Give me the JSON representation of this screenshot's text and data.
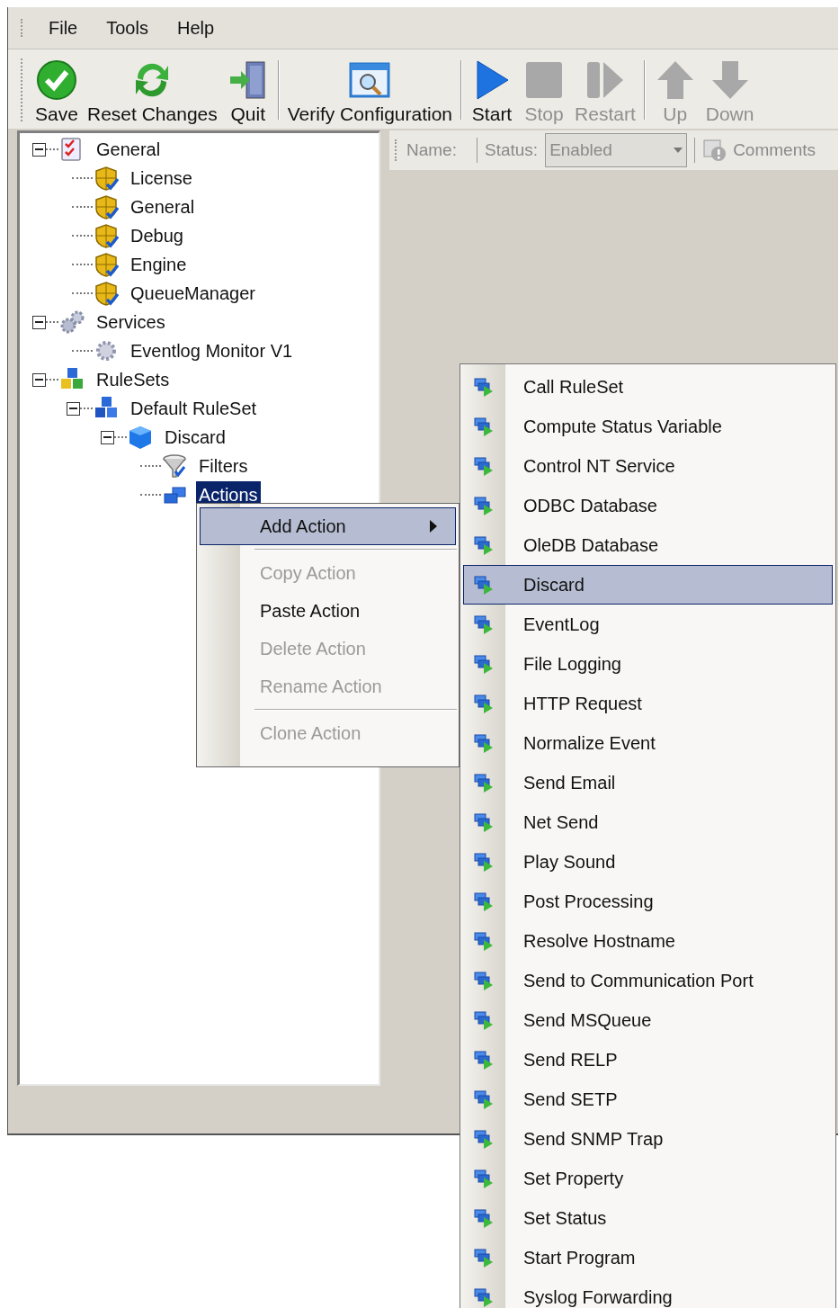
{
  "menu_bar": [
    "File",
    "Tools",
    "Help"
  ],
  "toolbar": [
    [
      {
        "label": "Save",
        "kind": "save",
        "disabled": false
      },
      {
        "label": "Reset Changes",
        "kind": "reset",
        "disabled": false
      },
      {
        "label": "Quit",
        "kind": "quit",
        "disabled": false
      }
    ],
    [
      {
        "label": "Verify Configuration",
        "kind": "verify",
        "disabled": false
      }
    ],
    [
      {
        "label": "Start",
        "kind": "start",
        "disabled": false
      },
      {
        "label": "Stop",
        "kind": "stop",
        "disabled": true
      },
      {
        "label": "Restart",
        "kind": "restart",
        "disabled": true
      }
    ],
    [
      {
        "label": "Up",
        "kind": "up",
        "disabled": true
      },
      {
        "label": "Down",
        "kind": "down",
        "disabled": true
      }
    ]
  ],
  "tree": [
    {
      "label": "General",
      "kind": "checklist",
      "expanded": true,
      "selected": false,
      "children": [
        {
          "label": "License",
          "kind": "setting",
          "selected": false
        },
        {
          "label": "General",
          "kind": "setting",
          "selected": false
        },
        {
          "label": "Debug",
          "kind": "setting",
          "selected": false
        },
        {
          "label": "Engine",
          "kind": "setting",
          "selected": false
        },
        {
          "label": "QueueManager",
          "kind": "setting",
          "selected": false
        }
      ]
    },
    {
      "label": "Services",
      "kind": "gears",
      "expanded": true,
      "selected": false,
      "children": [
        {
          "label": "Eventlog Monitor V1",
          "kind": "gear",
          "selected": false
        }
      ]
    },
    {
      "label": "RuleSets",
      "kind": "blocks",
      "expanded": true,
      "selected": false,
      "children": [
        {
          "label": "Default RuleSet",
          "kind": "ruleset",
          "expanded": true,
          "selected": false,
          "children": [
            {
              "label": "Discard",
              "kind": "cube",
              "expanded": true,
              "selected": false,
              "children": [
                {
                  "label": "Filters",
                  "kind": "funnel",
                  "selected": false
                },
                {
                  "label": "Actions",
                  "kind": "actions",
                  "selected": true
                }
              ]
            }
          ]
        }
      ]
    }
  ],
  "detail_bar": {
    "name_label": "Name:",
    "status_label": "Status:",
    "status_value": "Enabled",
    "status_disabled": true,
    "comments": "Comments",
    "comments_disabled": true
  },
  "context_menu": [
    {
      "kind": "item",
      "label": "Add Action",
      "submenu": true,
      "selected": true,
      "disabled": false
    },
    {
      "kind": "separator"
    },
    {
      "kind": "item",
      "label": "Copy Action",
      "submenu": false,
      "selected": false,
      "disabled": true
    },
    {
      "kind": "item",
      "label": "Paste Action",
      "submenu": false,
      "selected": false,
      "disabled": false
    },
    {
      "kind": "item",
      "label": "Delete Action",
      "submenu": false,
      "selected": false,
      "disabled": true
    },
    {
      "kind": "item",
      "label": "Rename Action",
      "submenu": false,
      "selected": false,
      "disabled": true
    },
    {
      "kind": "separator"
    },
    {
      "kind": "item",
      "label": "Clone Action",
      "submenu": false,
      "selected": false,
      "disabled": true
    }
  ],
  "submenu": [
    {
      "label": "Call RuleSet",
      "selected": false
    },
    {
      "label": "Compute Status Variable",
      "selected": false
    },
    {
      "label": "Control NT Service",
      "selected": false
    },
    {
      "label": "ODBC Database",
      "selected": false
    },
    {
      "label": "OleDB Database",
      "selected": false
    },
    {
      "label": "Discard",
      "selected": true
    },
    {
      "label": "EventLog",
      "selected": false
    },
    {
      "label": "File Logging",
      "selected": false
    },
    {
      "label": "HTTP Request",
      "selected": false
    },
    {
      "label": "Normalize Event",
      "selected": false
    },
    {
      "label": "Send Email",
      "selected": false
    },
    {
      "label": "Net Send",
      "selected": false
    },
    {
      "label": "Play Sound",
      "selected": false
    },
    {
      "label": "Post Processing",
      "selected": false
    },
    {
      "label": "Resolve Hostname",
      "selected": false
    },
    {
      "label": "Send to Communication Port",
      "selected": false
    },
    {
      "label": "Send MSQueue",
      "selected": false
    },
    {
      "label": "Send RELP",
      "selected": false
    },
    {
      "label": "Send SETP",
      "selected": false
    },
    {
      "label": "Send SNMP Trap",
      "selected": false
    },
    {
      "label": "Set Property",
      "selected": false
    },
    {
      "label": "Set Status",
      "selected": false
    },
    {
      "label": "Start Program",
      "selected": false
    },
    {
      "label": "Syslog Forwarding",
      "selected": false
    }
  ]
}
